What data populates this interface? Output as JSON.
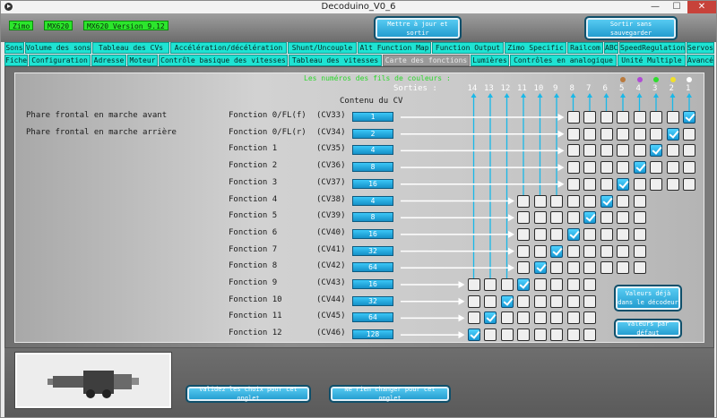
{
  "window": {
    "title": "Decoduino_V0_6",
    "min_label": "—",
    "max_label": "☐",
    "close_label": "✕"
  },
  "status": [
    "Zimo",
    "MX620",
    "MX620 Version 9.12"
  ],
  "top_buttons": {
    "update_exit": "Mettre à jour et sortir",
    "exit_nosave": "Sortir sans sauvegarder"
  },
  "tabs_row1": [
    "Sons",
    "Volume des sons",
    "Tableau des CVs",
    "Accélération/décélération",
    "Shunt/Uncouple",
    "Alt Function Map",
    "Function Output",
    "Zimo Specific",
    "Railcom",
    "ABC",
    "SpeedRegulation",
    "Servos"
  ],
  "tabs_row2": [
    "Fiche",
    "Configuration",
    "Adresse",
    "Moteur",
    "Contrôle basique des vitesses",
    "Tableau des vitesses",
    "Carte des fonctions",
    "Lumières",
    "Contrôles en analogique",
    "Unité Multiple",
    "Avancé"
  ],
  "active_tab": "Carte des fonctions",
  "grid": {
    "header_note": "Les numéros des fils de couleurs :",
    "outputs_label": "Sorties :",
    "outputs": [
      "14",
      "13",
      "12",
      "11",
      "10",
      "9",
      "8",
      "7",
      "6",
      "5",
      "4",
      "3",
      "2",
      "1"
    ],
    "dot_colors": {
      "5": "#b97a3c",
      "4": "#b04bd6",
      "3": "#2ddc2d",
      "2": "#f1e02a",
      "1": "#ffffff"
    }
  },
  "cv_header": "Contenu du CV",
  "rows": [
    {
      "desc": "Phare frontal en marche avant",
      "func": "Fonction 0/FL(f)",
      "cv": "(CV33)",
      "value": "1",
      "min": 1,
      "max": 8,
      "checked": 1
    },
    {
      "desc": "Phare frontal en marche arrière",
      "func": "Fonction 0/FL(r)",
      "cv": "(CV34)",
      "value": "2",
      "min": 1,
      "max": 8,
      "checked": 2
    },
    {
      "desc": "",
      "func": "Fonction 1",
      "cv": "(CV35)",
      "value": "4",
      "min": 1,
      "max": 8,
      "checked": 3
    },
    {
      "desc": "",
      "func": "Fonction 2",
      "cv": "(CV36)",
      "value": "8",
      "min": 1,
      "max": 8,
      "checked": 4
    },
    {
      "desc": "",
      "func": "Fonction 3",
      "cv": "(CV37)",
      "value": "16",
      "min": 1,
      "max": 8,
      "checked": 5
    },
    {
      "desc": "",
      "func": "Fonction 4",
      "cv": "(CV38)",
      "value": "4",
      "min": 4,
      "max": 11,
      "checked": 6
    },
    {
      "desc": "",
      "func": "Fonction 5",
      "cv": "(CV39)",
      "value": "8",
      "min": 4,
      "max": 11,
      "checked": 7
    },
    {
      "desc": "",
      "func": "Fonction 6",
      "cv": "(CV40)",
      "value": "16",
      "min": 4,
      "max": 11,
      "checked": 8
    },
    {
      "desc": "",
      "func": "Fonction 7",
      "cv": "(CV41)",
      "value": "32",
      "min": 4,
      "max": 11,
      "checked": 9
    },
    {
      "desc": "",
      "func": "Fonction 8",
      "cv": "(CV42)",
      "value": "64",
      "min": 4,
      "max": 11,
      "checked": 10
    },
    {
      "desc": "",
      "func": "Fonction 9",
      "cv": "(CV43)",
      "value": "16",
      "min": 7,
      "max": 14,
      "checked": 11
    },
    {
      "desc": "",
      "func": "Fonction 10",
      "cv": "(CV44)",
      "value": "32",
      "min": 7,
      "max": 14,
      "checked": 12
    },
    {
      "desc": "",
      "func": "Fonction 11",
      "cv": "(CV45)",
      "value": "64",
      "min": 7,
      "max": 14,
      "checked": 13
    },
    {
      "desc": "",
      "func": "Fonction 12",
      "cv": "(CV46)",
      "value": "128",
      "min": 7,
      "max": 14,
      "checked": 14
    }
  ],
  "side_buttons": {
    "decoder_values": "Valeurs déjà dans le décodeur",
    "defaults": "Valeurs par défaut"
  },
  "bottom_buttons": {
    "validate": "Validez les choix pour cet onglet",
    "nochange": "Ne rien changer pour cet onglet"
  }
}
